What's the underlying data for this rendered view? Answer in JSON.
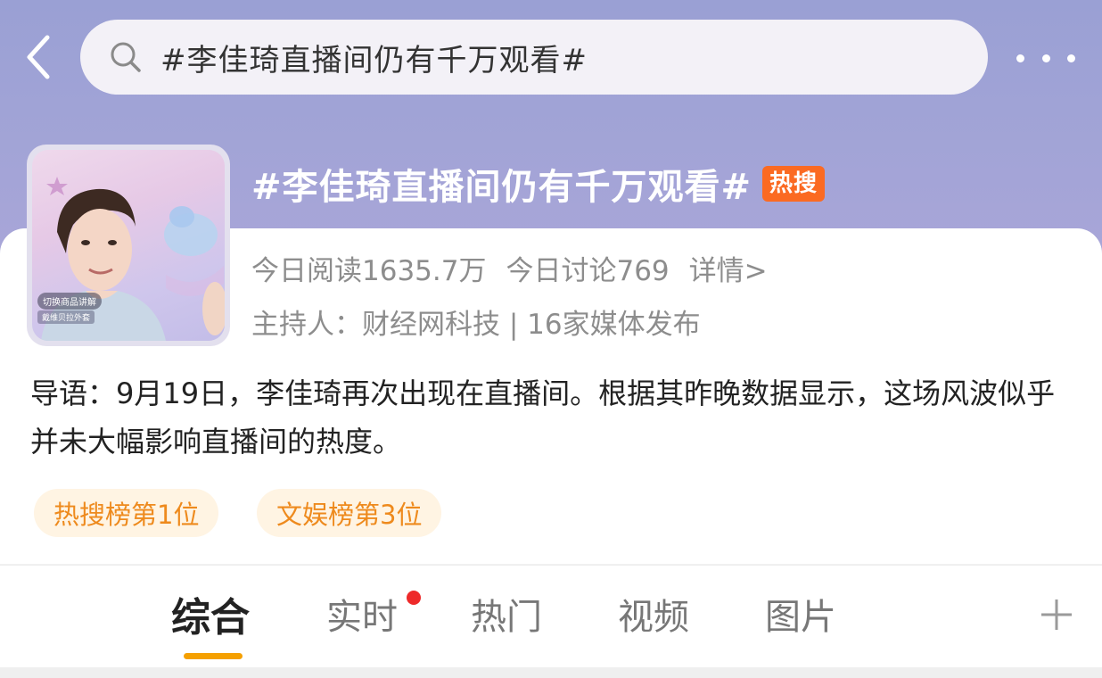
{
  "search": {
    "query": "#李佳琦直播间仍有千万观看#"
  },
  "topic": {
    "title": "#李佳琦直播间仍有千万观看#",
    "badge": "热搜",
    "read_today": "今日阅读1635.7万",
    "discuss_today": "今日讨论769",
    "details_link": "详情>",
    "host_line": "主持人：财经网科技 | 16家媒体发布",
    "intro": "导语：9月19日，李佳琦再次出现在直播间。根据其昨晚数据显示，这场风波似乎并未大幅影响直播间的热度。",
    "cover_caption_1": "切换商品讲解",
    "cover_caption_2": "戴维贝拉外套"
  },
  "rank_tags": [
    "热搜榜第1位",
    "文娱榜第3位"
  ],
  "tabs": [
    {
      "label": "综合",
      "active": true
    },
    {
      "label": "实时",
      "active": false,
      "has_dot": true
    },
    {
      "label": "热门",
      "active": false
    },
    {
      "label": "视频",
      "active": false
    },
    {
      "label": "图片",
      "active": false
    }
  ],
  "icons": {
    "back": "chevron-left-icon",
    "search": "search-icon",
    "more": "more-dots-icon",
    "add": "plus-icon"
  },
  "colors": {
    "header_gradient_top": "#9aa0d4",
    "hot_badge": "#fb6a22",
    "tag_text": "#ee8a1d",
    "tag_bg": "#fff4e3",
    "tab_underline": "#f5a000",
    "notify_dot": "#ee2a2a"
  }
}
